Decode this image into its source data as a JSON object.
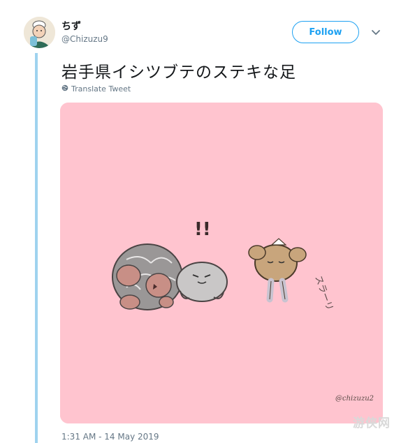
{
  "tweet": {
    "display_name": "ちず",
    "handle": "@Chizuzu9",
    "follow_label": "Follow",
    "text": "岩手県イシツブテのステキな足",
    "translate_label": "Translate Tweet",
    "timestamp": "1:31 AM - 14 May 2019"
  },
  "media": {
    "exclaim": "!!",
    "sound_effect": "スラーリ",
    "signature": "@chizuzu2"
  },
  "watermark": "游侠网",
  "colors": {
    "accent": "#1da1f2",
    "thread_line": "#9fd3ef",
    "media_background": "#ffc4cf"
  },
  "icons": {
    "menu": "chevron-down-icon",
    "translate": "globe-icon"
  }
}
